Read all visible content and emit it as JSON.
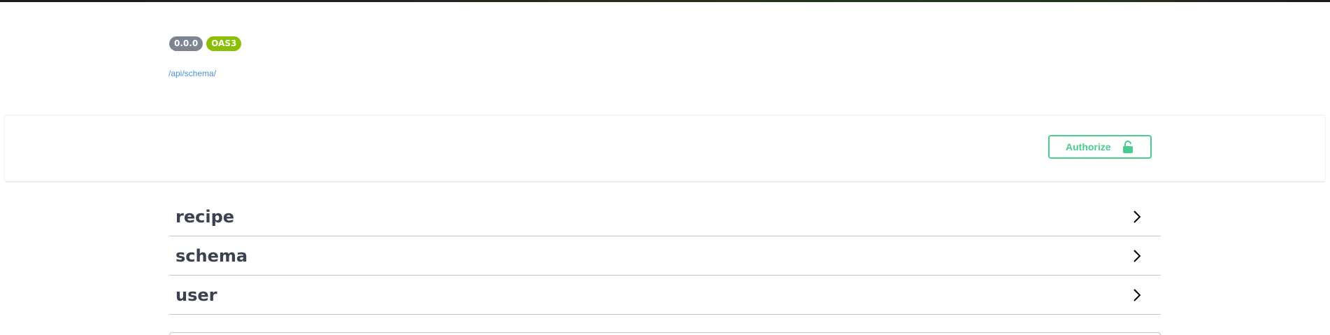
{
  "info": {
    "version_badge": "0.0.0",
    "oas_badge": "OAS3",
    "schema_link": "/api/schema/"
  },
  "auth": {
    "authorize_label": "Authorize",
    "icon": "unlocked-lock-icon"
  },
  "tags": [
    {
      "label": "recipe",
      "icon": "chevron-right-icon"
    },
    {
      "label": "schema",
      "icon": "chevron-right-icon"
    },
    {
      "label": "user",
      "icon": "chevron-right-icon"
    }
  ],
  "colors": {
    "accent_green": "#49cc90",
    "version_badge": "#7d8492",
    "oas_badge": "#89bf04",
    "link": "#4990e2",
    "text": "#3b4151"
  }
}
